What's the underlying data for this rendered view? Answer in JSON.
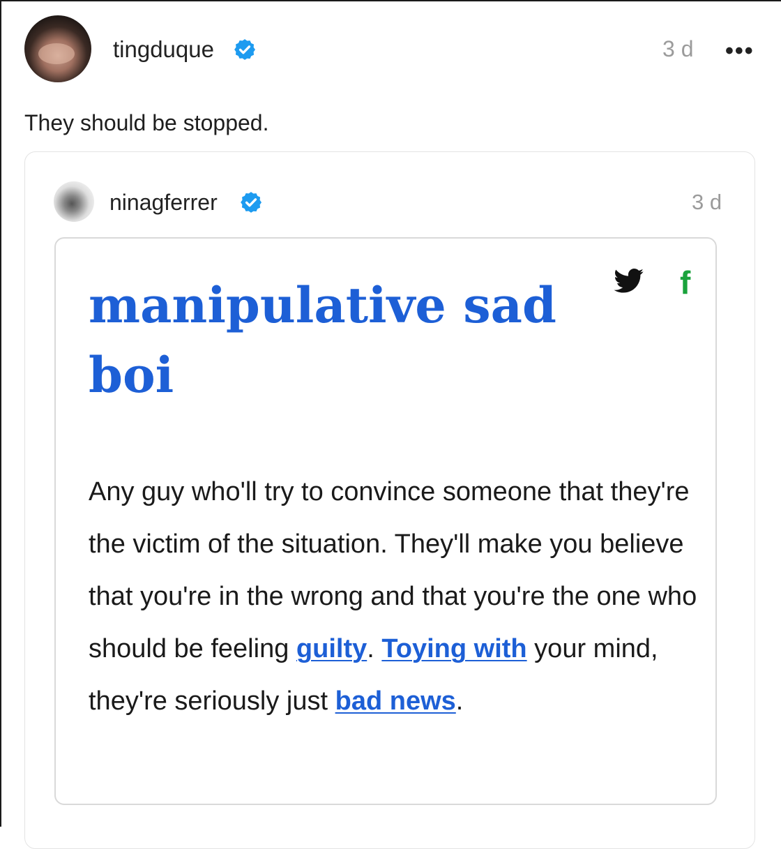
{
  "post": {
    "username": "tingduque",
    "verified": true,
    "time": "3 d",
    "more_icon": "ellipsis-icon",
    "text": "They should be stopped."
  },
  "quoted": {
    "username": "ninagferrer",
    "verified": true,
    "time": "3 d"
  },
  "definition": {
    "title": "manipulative sad boi",
    "share_icons": [
      "twitter-icon",
      "facebook-icon"
    ],
    "body_parts": {
      "p1": "Any guy who'll try to convince someone that they're the victim of the situation. They'll make you believe that you're in the wrong and that you're the one who should be feeling ",
      "link1": "guilty",
      "p2": ". ",
      "link2": "Toying with",
      "p3": " your mind, they're seriously just ",
      "link3": "bad news",
      "p4": "."
    }
  },
  "colors": {
    "link_blue": "#1d5fd6",
    "verified_blue": "#1d9bf0",
    "facebook_green": "#1aa33c",
    "muted_gray": "#9b9b9b"
  }
}
